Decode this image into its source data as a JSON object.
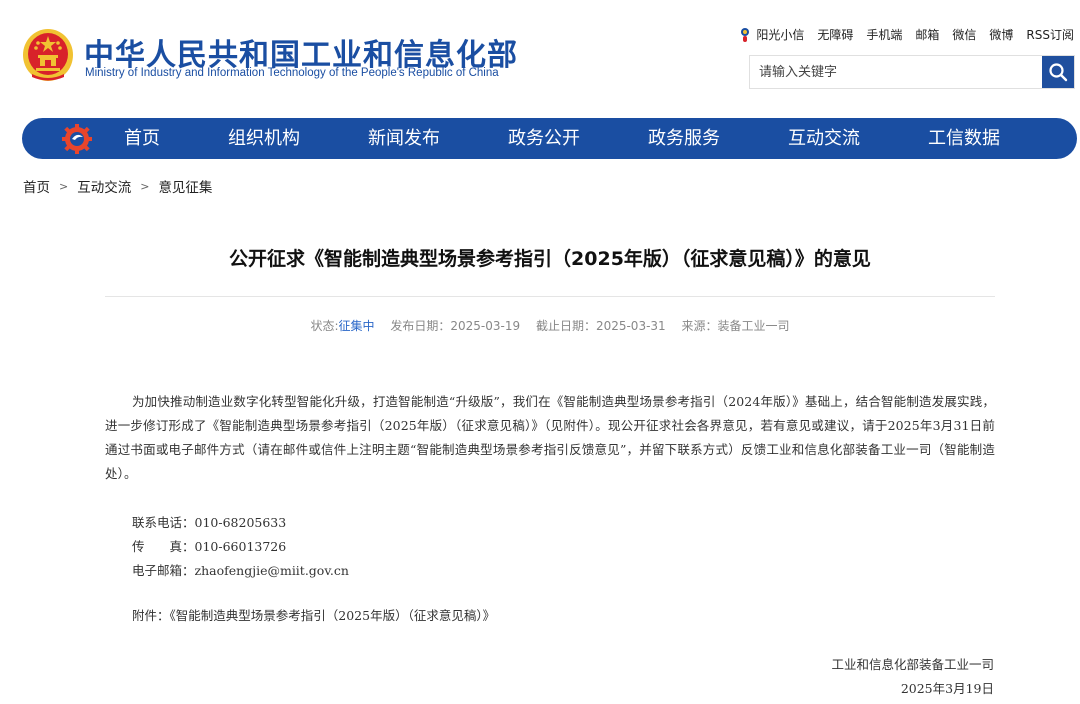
{
  "header": {
    "logo_cn": "中华人民共和国工业和信息化部",
    "logo_en": "Ministry of Industry and Information Technology of the People's Republic of China",
    "top_links": [
      "阳光小信",
      "无障碍",
      "手机端",
      "邮箱",
      "微信",
      "微博",
      "RSS订阅"
    ],
    "search_placeholder": "请输入关键字"
  },
  "nav": {
    "items": [
      "首页",
      "组织机构",
      "新闻发布",
      "政务公开",
      "政务服务",
      "互动交流",
      "工信数据"
    ]
  },
  "breadcrumb": {
    "items": [
      "首页",
      "互动交流",
      "意见征集"
    ],
    "separator": ">"
  },
  "article": {
    "title": "公开征求《智能制造典型场景参考指引（2025年版）（征求意见稿）》的意见",
    "meta": {
      "status_label": "状态:",
      "status_value": "征集中",
      "publish": "发布日期：2025-03-19",
      "deadline": "截止日期：2025-03-31",
      "source": "来源：装备工业一司"
    },
    "paragraph": "为加快推动制造业数字化转型智能化升级，打造智能制造“升级版”，我们在《智能制造典型场景参考指引（2024年版）》基础上，结合智能制造发展实践，进一步修订形成了《智能制造典型场景参考指引（2025年版）（征求意见稿）》（见附件）。现公开征求社会各界意见，若有意见或建议，请于2025年3月31日前通过书面或电子邮件方式（请在邮件或信件上注明主题“智能制造典型场景参考指引反馈意见”，并留下联系方式）反馈工业和信息化部装备工业一司（智能制造处）。",
    "contacts": {
      "phone": "联系电话：010-68205633",
      "fax": "传　　真：010-66013726",
      "email": "电子邮箱：zhaofengjie@miit.gov.cn"
    },
    "attachment_label": "附件：",
    "attachment_link": "《智能制造典型场景参考指引（2025年版）（征求意见稿）》",
    "signature": {
      "org": "工业和信息化部装备工业一司",
      "date": "2025年3月19日"
    }
  },
  "colors": {
    "brand_blue": "#1a4ea2",
    "status_blue": "#2a67c8",
    "emblem_red": "#d8222a",
    "emblem_gold": "#f1c232"
  }
}
